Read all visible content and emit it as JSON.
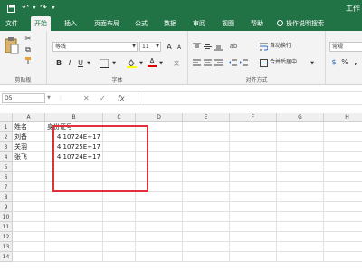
{
  "title_bar": {
    "title": "工作"
  },
  "tabs": [
    "文件",
    "开始",
    "插入",
    "页面布局",
    "公式",
    "数据",
    "审阅",
    "视图",
    "帮助",
    "操作说明搜索"
  ],
  "ribbon": {
    "font_name": "等线",
    "font_size": "11",
    "font_size_up": "A",
    "font_size_down": "A",
    "bold": "B",
    "italic": "I",
    "underline": "U",
    "font_color_letter": "A",
    "wrap_text": "自动换行",
    "merge_center": "合并后居中",
    "number_format": "常规",
    "percent": "%",
    "comma": ",",
    "groups": {
      "clipboard": "剪贴板",
      "font": "字体",
      "alignment": "对齐方式"
    }
  },
  "formula_bar": {
    "name_box": "D5",
    "cancel": "✕",
    "enter": "✓",
    "fx": "fx",
    "content": ""
  },
  "sheet": {
    "columns": [
      "A",
      "B",
      "C",
      "D",
      "E",
      "F",
      "G",
      "H"
    ],
    "rows": [
      "1",
      "2",
      "3",
      "4",
      "5",
      "6",
      "7",
      "8",
      "9",
      "10",
      "11",
      "12",
      "13",
      "14"
    ],
    "header_a": "姓名",
    "header_b": "身份证号",
    "names": [
      "刘备",
      "关羽",
      "张飞"
    ],
    "ids": [
      "4.10724E+17",
      "4.10725E+17",
      "4.10724E+17"
    ]
  },
  "colors": {
    "accent": "#217346",
    "highlight_box": "#e0303b"
  }
}
